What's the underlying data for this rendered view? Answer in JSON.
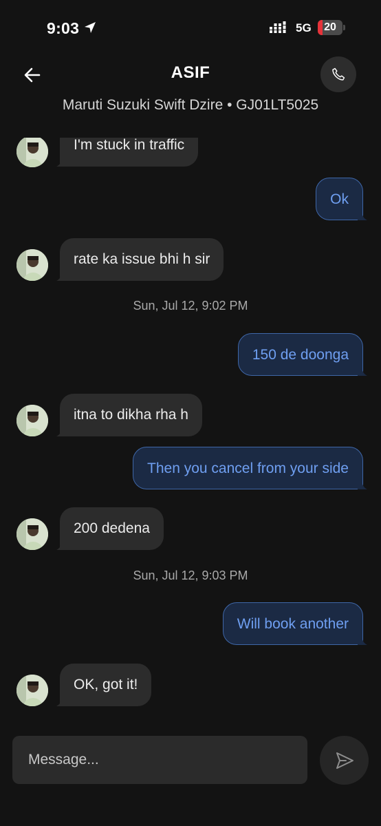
{
  "status_bar": {
    "time": "9:03",
    "network": "5G",
    "battery_level": 20,
    "battery_label": "20",
    "battery_color": "#e7333a",
    "icons": [
      "location-arrow-icon",
      "signal-bars-icon",
      "battery-icon"
    ]
  },
  "header": {
    "contact_name": "ASIF",
    "vehicle_info": "Maruti Suzuki Swift Dzire • GJ01LT5025",
    "icons": [
      "back-arrow-icon",
      "phone-icon"
    ]
  },
  "messages": [
    {
      "direction": "in",
      "text": "I'm stuck in traffic"
    },
    {
      "direction": "out",
      "text": "Ok"
    },
    {
      "direction": "in",
      "text": "rate ka issue bhi h sir"
    },
    {
      "type": "timestamp",
      "text": "Sun, Jul 12, 9:02 PM"
    },
    {
      "direction": "out",
      "text": "150 de doonga"
    },
    {
      "direction": "in",
      "text": "itna to dikha rha h"
    },
    {
      "direction": "out",
      "text": "Then you cancel from your side"
    },
    {
      "direction": "in",
      "text": "200 dedena"
    },
    {
      "type": "timestamp",
      "text": "Sun, Jul 12, 9:03 PM"
    },
    {
      "direction": "out",
      "text": "Will book another"
    },
    {
      "direction": "in",
      "text": "OK, got it!"
    }
  ],
  "composer": {
    "placeholder": "Message...",
    "send_icon": "send-icon"
  },
  "colors": {
    "background": "#131313",
    "incoming_bubble": "#2c2c2c",
    "outgoing_bubble": "#1b2a44",
    "outgoing_text": "#6f9ff1",
    "outgoing_border": "#3f67a8"
  }
}
